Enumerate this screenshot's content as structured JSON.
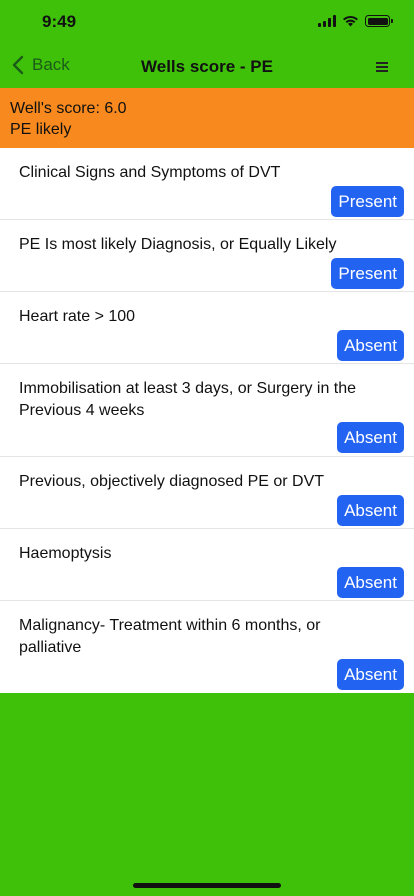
{
  "status_bar": {
    "time": "9:49"
  },
  "nav": {
    "back_label": "Back",
    "title": "Wells score - PE",
    "menu_icon": "hamburger-menu-icon"
  },
  "score": {
    "line1": "Well's score: 6.0",
    "line2": "PE likely"
  },
  "criteria": [
    {
      "label": "Clinical Signs and Symptoms of DVT",
      "value": "Present"
    },
    {
      "label": "PE Is most likely Diagnosis, or Equally Likely",
      "value": "Present"
    },
    {
      "label": "Heart rate > 100",
      "value": "Absent"
    },
    {
      "label": "Immobilisation at least 3 days, or Surgery in the Previous 4 weeks",
      "value": "Absent"
    },
    {
      "label": "Previous, objectively diagnosed PE or DVT",
      "value": "Absent"
    },
    {
      "label": "Haemoptysis",
      "value": "Absent"
    },
    {
      "label": "Malignancy- Treatment within 6 months, or palliative",
      "value": "Absent"
    }
  ],
  "colors": {
    "background": "#3fc10a",
    "banner": "#f7891e",
    "button": "#2363f1"
  }
}
